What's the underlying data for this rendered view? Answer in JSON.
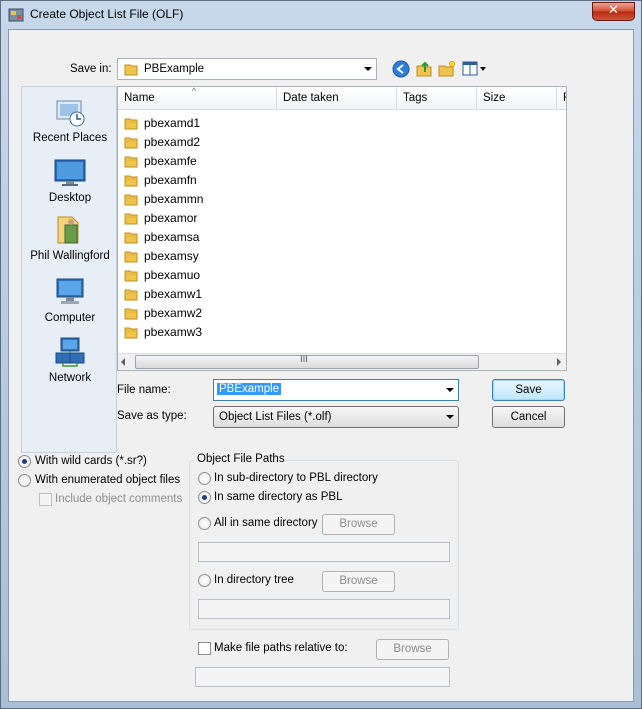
{
  "window": {
    "title": "Create Object List File (OLF)",
    "close_label": "✕"
  },
  "save_in": {
    "label": "Save in:",
    "value": "PBExample"
  },
  "places": [
    {
      "label": "Recent Places",
      "icon": "recent-places-icon"
    },
    {
      "label": "Desktop",
      "icon": "desktop-icon"
    },
    {
      "label": "Phil Wallingford",
      "icon": "user-folder-icon"
    },
    {
      "label": "Computer",
      "icon": "computer-icon"
    },
    {
      "label": "Network",
      "icon": "network-icon"
    }
  ],
  "file_list": {
    "columns": [
      "Name",
      "Date taken",
      "Tags",
      "Size",
      "R"
    ],
    "sort_glyph": "^",
    "files": [
      "pbexamd1",
      "pbexamd2",
      "pbexamfe",
      "pbexamfn",
      "pbexammn",
      "pbexamor",
      "pbexamsa",
      "pbexamsy",
      "pbexamuo",
      "pbexamw1",
      "pbexamw2",
      "pbexamw3"
    ],
    "scroll_grip": "III"
  },
  "file_name": {
    "label": "File name:",
    "value": "PBExample"
  },
  "save_as_type": {
    "label": "Save as type:",
    "value": "Object List Files (*.olf)"
  },
  "buttons": {
    "save": "Save",
    "cancel": "Cancel",
    "browse": "Browse"
  },
  "options": {
    "wild_cards": "With wild cards (*.sr?)",
    "enumerated": "With enumerated object files",
    "include_comments": "Include object comments"
  },
  "object_file_paths": {
    "title": "Object File Paths",
    "sub_directory": "In sub-directory to PBL directory",
    "same_directory": "In same directory as PBL",
    "all_same": "All in same directory",
    "in_tree": "In directory tree",
    "relative": "Make file paths relative to:"
  },
  "colors": {
    "accent": "#3399ff",
    "window_frame": "#b9cde0"
  }
}
